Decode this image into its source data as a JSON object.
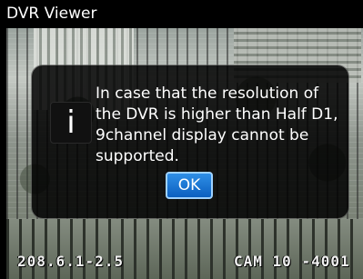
{
  "window": {
    "title": "DVR Viewer"
  },
  "video": {
    "osd_date": "208.6.1-2.5",
    "osd_camera": "CAM 10 -4001"
  },
  "dialog": {
    "icon": "info-icon",
    "message": "In case that the resolution of the DVR is higher than Half D1, 9channel display cannot be supported.",
    "ok_label": "OK",
    "accent_color": "#1a73d9"
  }
}
